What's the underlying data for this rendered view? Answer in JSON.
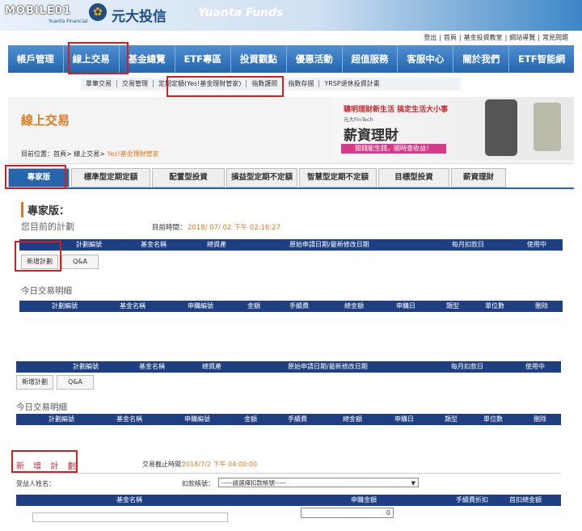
{
  "header": {
    "site_logo": "MOBILE01",
    "company_sub": "Yuanta Financial",
    "brand_cn": "元大投信",
    "brand_en": "Yuanta Funds",
    "logo_glyph": "✿"
  },
  "top_links": [
    "登出",
    "首頁",
    "基金投資教室",
    "網站導覽",
    "常見問題"
  ],
  "nav": [
    "帳戶管理",
    "線上交易",
    "基金總覽",
    "ETF專區",
    "投資觀點",
    "優惠活動",
    "超值服務",
    "客服中心",
    "關於我們",
    "ETF智能網"
  ],
  "subnav": [
    "單筆交易",
    "交易管理",
    "定期定額(Yes!基金理財管家)",
    "指數護照",
    "指數存摺",
    "YRSP退休投資計畫"
  ],
  "page": {
    "title": "線上交易",
    "breadcrumb_prefix": "目前位置：首頁> 線上交易> ",
    "breadcrumb_current": "Yes!基金理財管家"
  },
  "banner": {
    "tagline": "聰明理財新生活 搞定生活大小事",
    "small": "元大FinTech",
    "title": "薪資理財",
    "cta": "閒錢能生錢，隨時查收益！"
  },
  "tabs": [
    "專家版",
    "標準型定期定額",
    "配置型投資",
    "損益型定期不定額",
    "智慧型定期不定額",
    "目標型投資",
    "薪資理財"
  ],
  "pro": {
    "heading": "專家版：",
    "current_plan": "您目前的計劃",
    "time_label": "目前時間：",
    "time_value": "2018/ 07/ 02 下午 02:16:27",
    "plan_columns": [
      "計劃編號",
      "基金名稱",
      "總資產",
      "原始申請日期/最新修改日期",
      "每月扣款日",
      "使用中"
    ],
    "add_plan_button": "新增計劃",
    "qa_button": "Q&A",
    "today_title": "今日交易明細",
    "today_columns": [
      "計劃編號",
      "基金名稱",
      "申購編號",
      "金額",
      "手續費",
      "總金額",
      "申購日",
      "類型",
      "單位數",
      "刪除"
    ]
  },
  "newplan": {
    "title": "新 增 計 劃",
    "cutoff_label": "交易截止時間：",
    "cutoff_value": "2018/7/2 下午 04:00:00",
    "payee_label": "受益人姓名：",
    "account_label": "扣款帳號：",
    "account_select": "-----請選擇扣款帳號-----",
    "columns": [
      "基金名稱",
      "申購金額",
      "手續費折扣",
      "首扣總金額"
    ],
    "amount_value": "0"
  },
  "colors": {
    "nav_blue": "#2465ad",
    "table_header": "#1f3f83",
    "accent_orange": "#e07a1f",
    "highlight_red": "#d11f24"
  }
}
